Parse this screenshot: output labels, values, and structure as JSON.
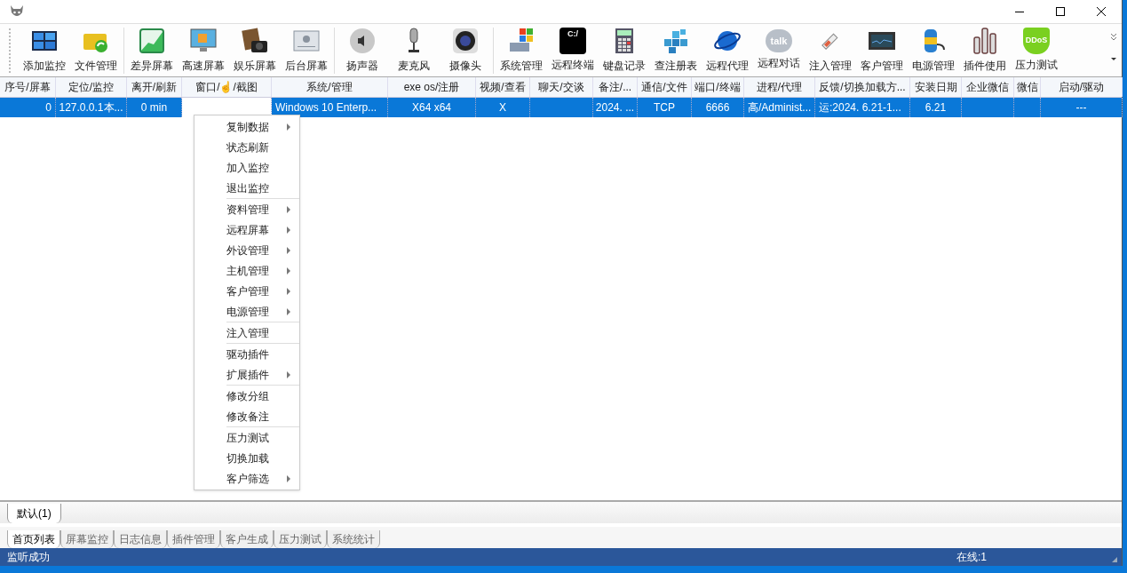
{
  "toolbar": [
    [
      "添加监控",
      "文件管理"
    ],
    [
      "差异屏幕",
      "高速屏幕",
      "娱乐屏幕",
      "后台屏幕"
    ],
    [
      "扬声器",
      "麦克风",
      "摄像头"
    ],
    [
      "系统管理",
      "远程终端",
      "键盘记录",
      "查注册表",
      "远程代理",
      "远程对话",
      "注入管理",
      "客户管理",
      "电源管理",
      "插件使用",
      "压力测试"
    ]
  ],
  "terminal_glyph": "C:/",
  "talk_glyph": "talk",
  "shield_glyph": "DDoS",
  "table": {
    "columns": [
      "序号/屏幕",
      "定位/监控",
      "离开/刷新",
      "窗口/☝/截图",
      "系统/管理",
      "exe os/注册",
      "视频/查看",
      "聊天/交谈",
      "备注/...",
      "通信/文件",
      "端口/终端",
      "进程/代理",
      "反馈/切换加载方...",
      "安装日期",
      "企业微信",
      "微信",
      "启动/驱动"
    ],
    "rows": [
      {
        "selected": true,
        "cells": [
          "0",
          "127.0.0.1本...",
          "0 min",
          "",
          "Windows 10 Enterp...",
          "X64 x64",
          "X",
          "",
          "2024. ...",
          "TCP",
          "6666",
          "高/Administ...",
          "运:2024. 6.21-1...",
          "6.21",
          "",
          "",
          "---"
        ]
      }
    ]
  },
  "context_menu": [
    [
      {
        "label": "复制数据",
        "submenu": true
      },
      {
        "label": "状态刷新",
        "submenu": false
      },
      {
        "label": "加入监控",
        "submenu": false
      },
      {
        "label": "退出监控",
        "submenu": false
      }
    ],
    [
      {
        "label": "资料管理",
        "submenu": true
      },
      {
        "label": "远程屏幕",
        "submenu": true
      },
      {
        "label": "外设管理",
        "submenu": true
      },
      {
        "label": "主机管理",
        "submenu": true
      },
      {
        "label": "客户管理",
        "submenu": true
      },
      {
        "label": "电源管理",
        "submenu": true
      }
    ],
    [
      {
        "label": "注入管理",
        "submenu": false
      }
    ],
    [
      {
        "label": "驱动插件",
        "submenu": false
      },
      {
        "label": "扩展插件",
        "submenu": true
      }
    ],
    [
      {
        "label": "修改分组",
        "submenu": false
      },
      {
        "label": "修改备注",
        "submenu": false
      }
    ],
    [
      {
        "label": "压力测试",
        "submenu": false
      },
      {
        "label": "切换加载",
        "submenu": false
      },
      {
        "label": "客户筛选",
        "submenu": true
      }
    ]
  ],
  "group_tabs": [
    {
      "label": "默认(1)",
      "selected": true
    }
  ],
  "page_tabs": [
    {
      "label": "首页列表",
      "selected": true
    },
    {
      "label": "屏幕监控",
      "selected": false
    },
    {
      "label": "日志信息",
      "selected": false
    },
    {
      "label": "插件管理",
      "selected": false
    },
    {
      "label": "客户生成",
      "selected": false
    },
    {
      "label": "压力测试",
      "selected": false
    },
    {
      "label": "系统统计",
      "selected": false
    }
  ],
  "status_bar": {
    "message": "监听成功",
    "online": "在线:1"
  }
}
